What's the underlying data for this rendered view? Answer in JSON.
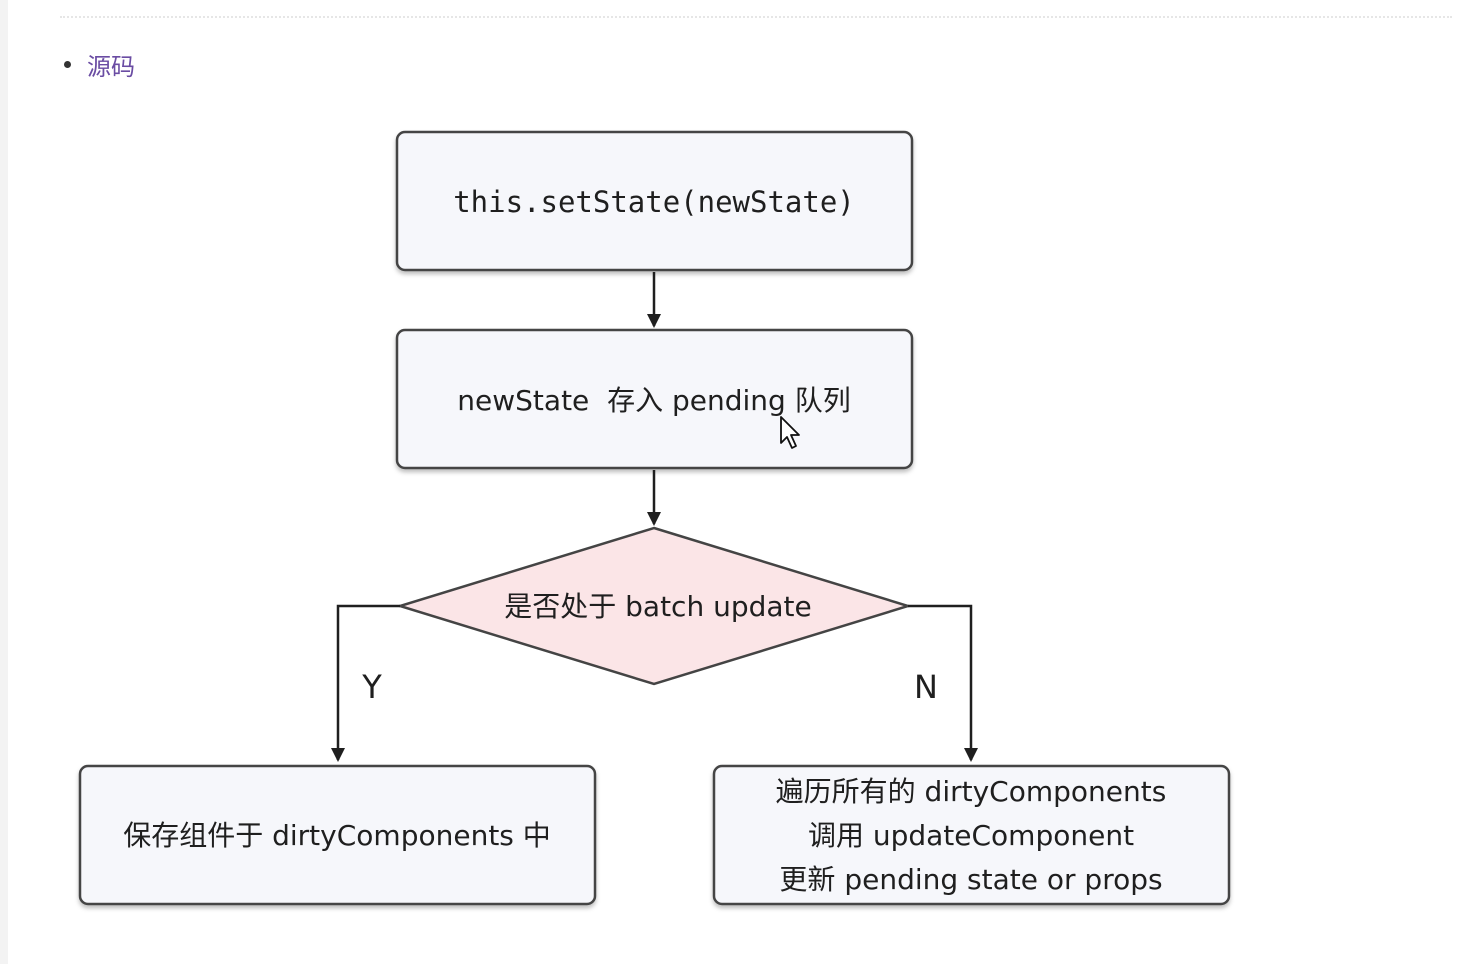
{
  "link": {
    "text": "源码"
  },
  "diagram": {
    "nodes": {
      "setstate": {
        "text": "this.setState(newState)"
      },
      "pending": {
        "text": "newState  存入 pending 队列"
      },
      "decision": {
        "text": "是否处于 batch update"
      },
      "save": {
        "text": "保存组件于 dirtyComponents 中"
      },
      "traverse": {
        "line1": "遍历所有的 dirtyComponents",
        "line2": "调用 updateComponent",
        "line3": "更新 pending state or props"
      }
    },
    "edges": {
      "yes_label": "Y",
      "no_label": "N"
    }
  },
  "colors": {
    "box_fill": "#f6f7fb",
    "box_stroke": "#444444",
    "decision_fill": "#fbe5e7",
    "link": "#6a4ca3"
  }
}
